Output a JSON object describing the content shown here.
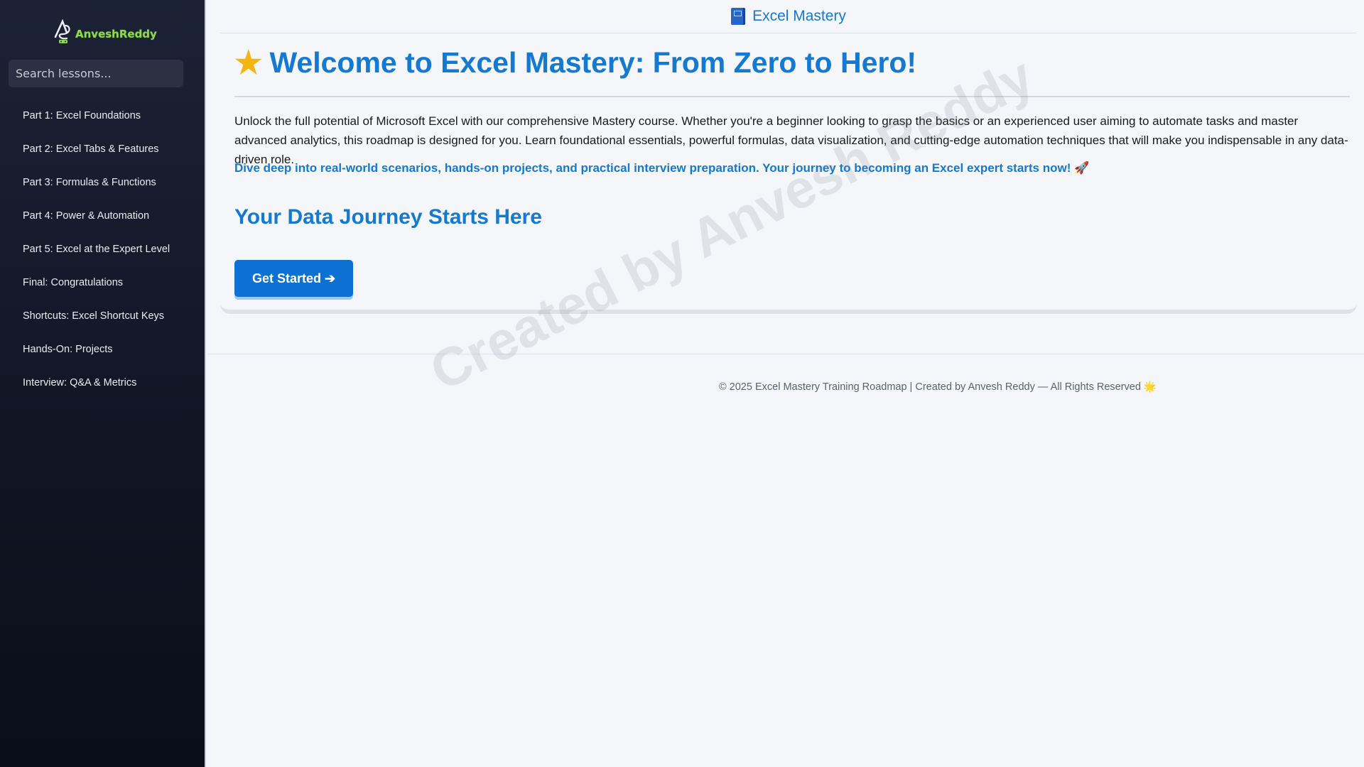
{
  "sidebar": {
    "logo_text": "AnveshReddy",
    "search_placeholder": "Search lessons...",
    "items": [
      {
        "label": "Part 1: Excel Foundations"
      },
      {
        "label": "Part 2: Excel Tabs & Features"
      },
      {
        "label": "Part 3: Formulas & Functions"
      },
      {
        "label": "Part 4: Power & Automation"
      },
      {
        "label": "Part 5: Excel at the Expert Level"
      },
      {
        "label": "Final: Congratulations"
      },
      {
        "label": "Shortcuts: Excel Shortcut Keys"
      },
      {
        "label": "Hands-On: Projects"
      },
      {
        "label": "Interview: Q&A & Metrics"
      }
    ]
  },
  "header": {
    "title": "Excel Mastery"
  },
  "main": {
    "hero_title": "Welcome to Excel Mastery: From Zero to Hero!",
    "intro": "Unlock the full potential of Microsoft Excel with our comprehensive Mastery course. Whether you're a beginner looking to grasp the basics or an experienced user aiming to automate tasks and master advanced analytics, this roadmap is designed for you. Learn foundational essentials, powerful formulas, data visualization, and cutting-edge automation techniques that will make you indispensable in any data-driven role.",
    "highlight": "Dive deep into real-world scenarios, hands-on projects, and practical interview preparation. Your journey to becoming an Excel expert starts now! 🚀",
    "subheading": "Your Data Journey Starts Here",
    "cta_label": "Get Started ➔"
  },
  "footer": {
    "text": "© 2025 Excel Mastery Training Roadmap | Created by Anvesh Reddy — All Rights Reserved 🌟"
  },
  "watermark": "Created by Anvesh Reddy",
  "colors": {
    "accent": "#1479d0",
    "button": "#0b72d4",
    "sidebar_bg": "#131827",
    "logo_green": "#8fd94a"
  }
}
